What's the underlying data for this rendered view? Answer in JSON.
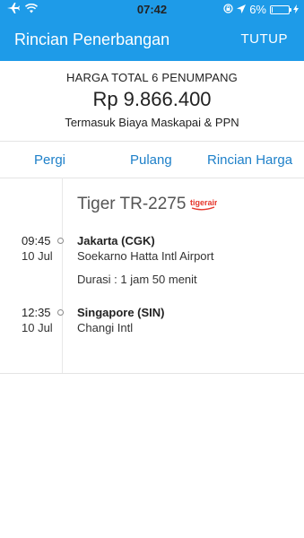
{
  "status_bar": {
    "time": "07:42",
    "battery": "6%",
    "battery_level": 0.06,
    "icons": [
      "airplane-icon",
      "wifi-icon",
      "rotation-lock-icon",
      "location-icon",
      "battery-icon",
      "charging-icon"
    ]
  },
  "nav": {
    "title": "Rincian Penerbangan",
    "close_label": "TUTUP"
  },
  "summary": {
    "label": "HARGA TOTAL 6 PENUMPANG",
    "price": "Rp 9.866.400",
    "note": "Termasuk Biaya Maskapai & PPN"
  },
  "tabs": [
    {
      "label": "Pergi"
    },
    {
      "label": "Pulang"
    },
    {
      "label": "Rincian Harga"
    }
  ],
  "flight": {
    "name": "Tiger TR-2275",
    "logo_text": "tigerair",
    "departure": {
      "time": "09:45",
      "date": "10 Jul",
      "city": "Jakarta (CGK)",
      "airport": "Soekarno Hatta Intl Airport"
    },
    "duration": "Durasi : 1 jam 50 menit",
    "arrival": {
      "time": "12:35",
      "date": "10 Jul",
      "city": "Singapore (SIN)",
      "airport": "Changi Intl"
    }
  },
  "colors": {
    "header_bg": "#1e9be8",
    "tab_text": "#1e80c9",
    "logo_red": "#e5352a"
  }
}
